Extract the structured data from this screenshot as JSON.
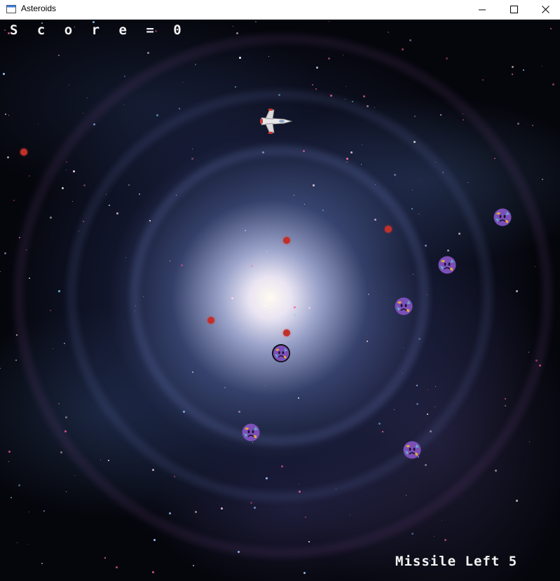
{
  "window": {
    "title": "Asteroids",
    "controls": [
      "minimize",
      "maximize",
      "close"
    ]
  },
  "hud": {
    "score_text": "S c o r e = 0",
    "missile_text": "Missile Left 5"
  },
  "sprites": {
    "ship": "spaceship-icon",
    "asteroid": "purple-face-asteroid-icon",
    "dot": "red-dot"
  },
  "colors": {
    "hud_text": "#f4f4f4",
    "dot": "#c0302a",
    "asteroid": "#7b4fb8"
  }
}
